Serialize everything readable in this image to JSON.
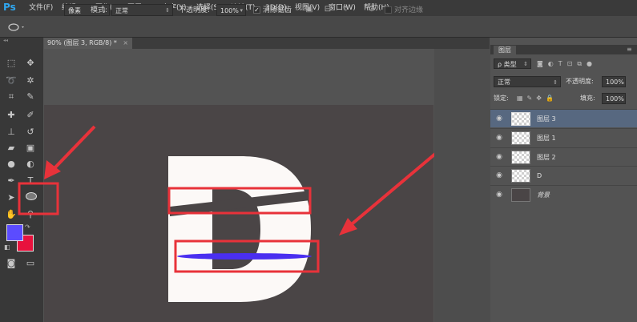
{
  "app": {
    "logo": "Ps"
  },
  "menu": [
    "文件(F)",
    "编辑(E)",
    "图像(I)",
    "图层(L)",
    "文字(Y)",
    "选择(S)",
    "滤镜(T)",
    "3D(D)",
    "视图(V)",
    "窗口(W)",
    "帮助(H)"
  ],
  "options": {
    "shape_mode": "像素",
    "mode_label": "模式:",
    "mode_value": "正常",
    "opacity_label": "不透明度:",
    "opacity_value": "100%",
    "antialias_checked": "✓",
    "antialias_label": "消除锯齿",
    "align_edges_label": "对齐边缘"
  },
  "document": {
    "tab_title": "90% (图层 3, RGB/8) *",
    "tab_close": "×"
  },
  "colors": {
    "foreground": "#5b4cff",
    "background": "#e8123d",
    "highlight": "#e8323a",
    "selected_layer": "#576880"
  },
  "layers_panel": {
    "tab": "图层",
    "filter_label": "ρ 类型",
    "blend_mode": "正常",
    "opacity_label": "不透明度:",
    "opacity_value": "100%",
    "lock_label": "锁定:",
    "fill_label": "填充:",
    "fill_value": "100%",
    "layers": [
      {
        "name": "图层 3",
        "selected": true
      },
      {
        "name": "图层 1",
        "selected": false
      },
      {
        "name": "图层 2",
        "selected": false
      },
      {
        "name": "D",
        "selected": false
      },
      {
        "name": "背景",
        "selected": false
      }
    ]
  },
  "icons": [
    "ellipse-tool-icon",
    "move-icon",
    "marquee-icon",
    "lasso-icon",
    "magic-wand-icon",
    "crop-icon",
    "eyedropper-icon",
    "healing-icon",
    "brush-icon",
    "stamp-icon",
    "history-brush-icon",
    "eraser-icon",
    "gradient-icon",
    "blur-icon",
    "dodge-icon",
    "pen-icon",
    "type-icon",
    "path-select-icon",
    "hand-icon",
    "zoom-icon",
    "eye-icon",
    "gear-icon"
  ]
}
